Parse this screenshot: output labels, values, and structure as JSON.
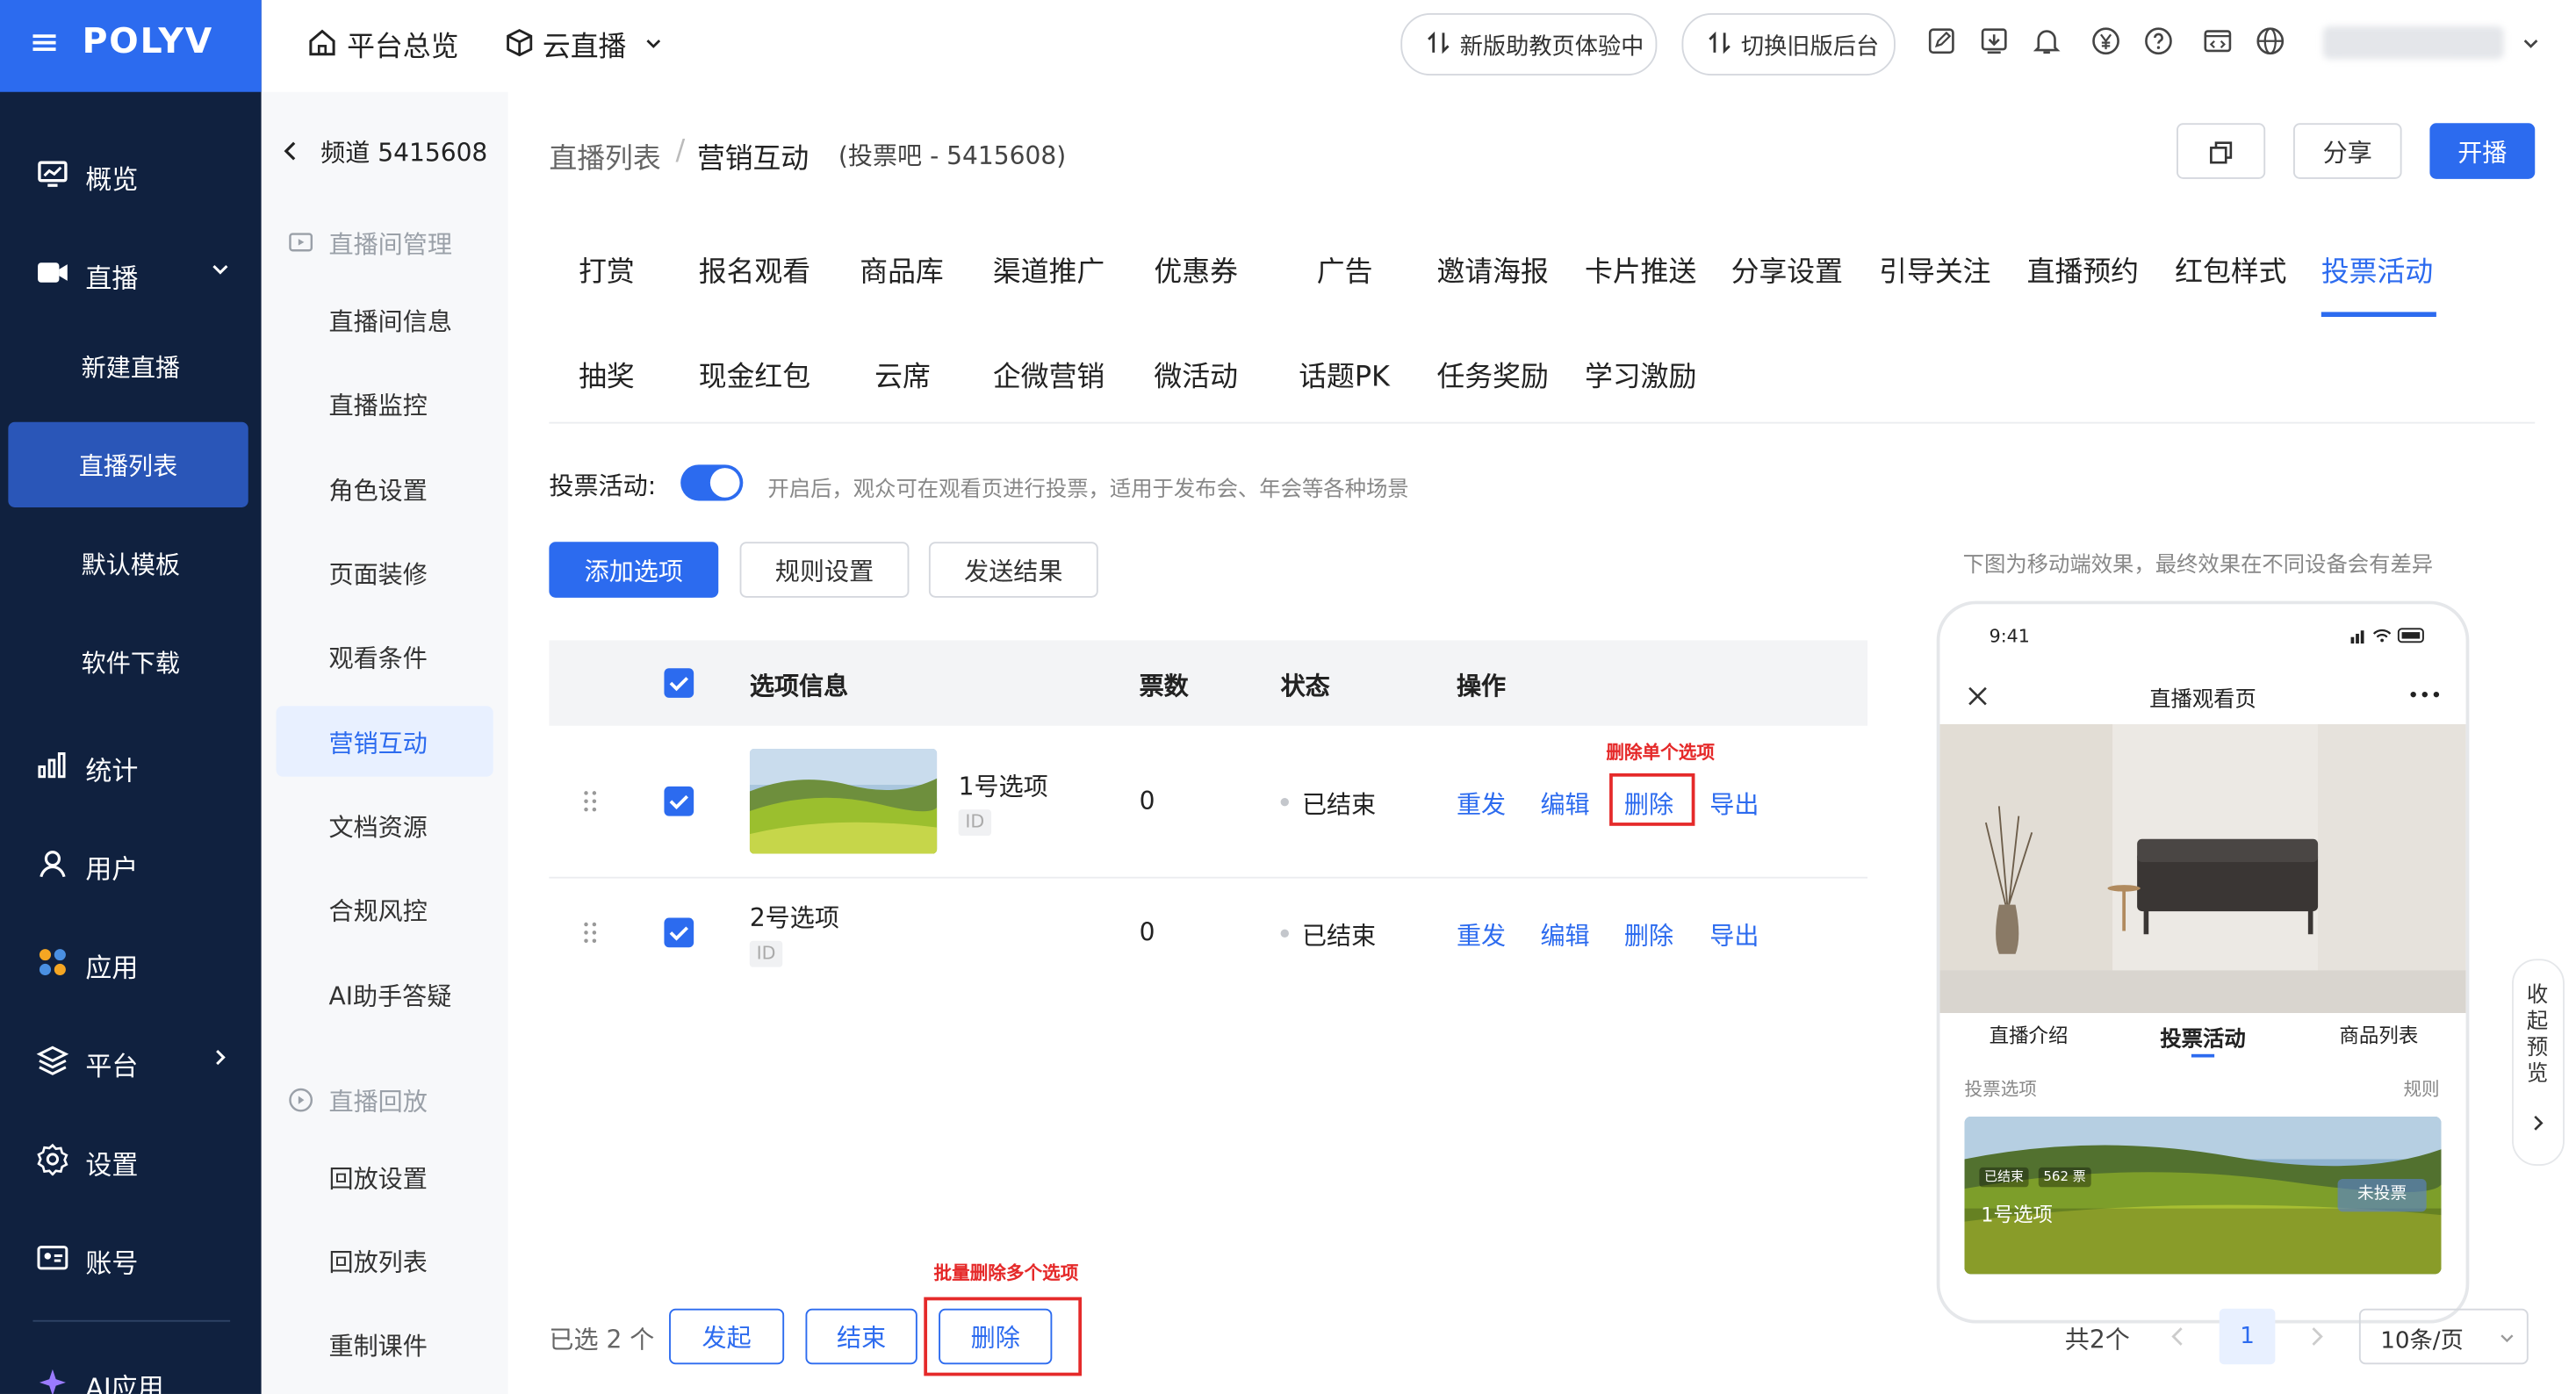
{
  "header": {
    "logo": "POLYV",
    "nav_overview": "平台总览",
    "nav_cloud": "云直播",
    "btn_new_assistant": "新版助教页体验中",
    "btn_switch_old": "切换旧版后台",
    "icons": [
      "edit-icon",
      "download-icon",
      "bell-icon",
      "yen-icon",
      "help-icon",
      "code-icon",
      "globe-icon"
    ],
    "accent": "#2c6bef"
  },
  "sidebar": {
    "items": [
      {
        "label": "概览",
        "icon": "monitor-icon"
      },
      {
        "label": "直播",
        "icon": "video-icon"
      },
      {
        "label": "统计",
        "icon": "bar-chart-icon"
      },
      {
        "label": "用户",
        "icon": "user-icon"
      },
      {
        "label": "应用",
        "icon": "apps-icon"
      },
      {
        "label": "平台",
        "icon": "layers-icon"
      },
      {
        "label": "设置",
        "icon": "gear-icon"
      },
      {
        "label": "账号",
        "icon": "id-card-icon"
      },
      {
        "label": "AI应用",
        "icon": "sparkle-icon"
      }
    ],
    "sub_items": [
      "新建直播",
      "直播列表",
      "默认模板",
      "软件下载"
    ],
    "active_sub": "直播列表"
  },
  "secondary": {
    "title": "频道 5415608",
    "group1": "直播间管理",
    "group1_items": [
      "直播间信息",
      "直播监控",
      "角色设置",
      "页面装修",
      "观看条件",
      "营销互动",
      "文档资源",
      "合规风控",
      "AI助手答疑"
    ],
    "group2": "直播回放",
    "group2_items": [
      "回放设置",
      "回放列表",
      "重制课件"
    ],
    "active": "营销互动"
  },
  "main": {
    "breadcrumb_list": "直播列表",
    "breadcrumb_sep": "/",
    "breadcrumb_current": "营销互动",
    "breadcrumb_sub": "(投票吧 - 5415608)",
    "share_label": "分享",
    "start_label": "开播",
    "tabs_row1": [
      "打赏",
      "报名观看",
      "商品库",
      "渠道推广",
      "优惠券",
      "广告",
      "邀请海报",
      "卡片推送",
      "分享设置",
      "引导关注",
      "直播预约",
      "红包样式",
      "投票活动"
    ],
    "tabs_row2": [
      "抽奖",
      "现金红包",
      "云席",
      "企微营销",
      "微活动",
      "话题PK",
      "任务奖励",
      "学习激励"
    ],
    "active_tab": "投票活动",
    "vote_label": "投票活动:",
    "vote_enabled": true,
    "vote_desc": "开启后，观众可在观看页进行投票，适用于发布会、年会等各种场景",
    "btn_add": "添加选项",
    "btn_rules": "规则设置",
    "btn_send": "发送结果",
    "table": {
      "columns": [
        "选项信息",
        "票数",
        "状态",
        "操作"
      ],
      "rows": [
        {
          "name": "1号选项",
          "id": "ID",
          "votes": "0",
          "status": "已结束",
          "actions": [
            "重发",
            "编辑",
            "删除",
            "导出"
          ]
        },
        {
          "name": "2号选项",
          "id": "ID",
          "votes": "0",
          "status": "已结束",
          "actions": [
            "重发",
            "编辑",
            "删除",
            "导出"
          ]
        }
      ]
    },
    "annotation_single": "删除单个选项",
    "annotation_batch": "批量删除多个选项",
    "selected_text": "已选 2 个",
    "batch_start": "发起",
    "batch_end": "结束",
    "batch_delete": "删除",
    "total": "共2个",
    "page": "1",
    "page_size": "10条/页"
  },
  "preview": {
    "note": "下图为移动端效果，最终效果在不同设备会有差异",
    "time": "9:41",
    "page_title": "直播观看页",
    "tabs": [
      "直播介绍",
      "投票活动",
      "商品列表"
    ],
    "section": "投票选项",
    "rules": "规则",
    "card_status": "已结束",
    "card_votes": "562 票",
    "card_name": "1号选项",
    "card_btn": "未投票",
    "collapse": "收起预览"
  }
}
